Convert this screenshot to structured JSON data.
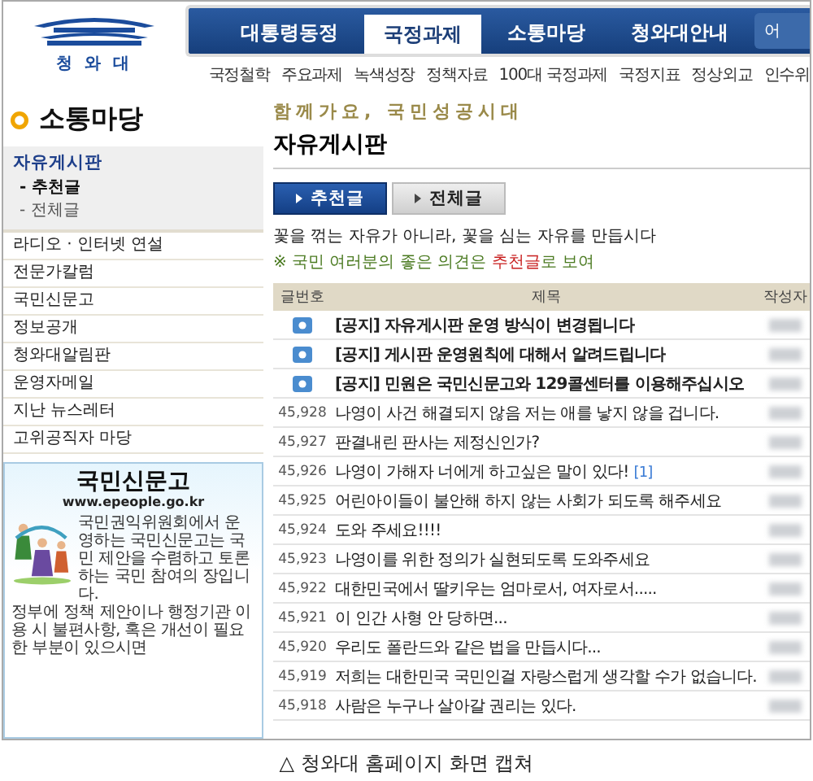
{
  "logo": {
    "text": "청 와 대"
  },
  "nav": {
    "tabs": [
      {
        "label": "대통령동정",
        "selected": false
      },
      {
        "label": "국정과제",
        "selected": true
      },
      {
        "label": "소통마당",
        "selected": false
      },
      {
        "label": "청와대안내",
        "selected": false
      }
    ],
    "search": {
      "value": "어"
    }
  },
  "subnav": [
    "국정철학",
    "주요과제",
    "녹색성장",
    "정책자료",
    "100대 국정과제",
    "국정지표",
    "정상외교",
    "인수위"
  ],
  "section_title": "소통마당",
  "sidebar": {
    "items": [
      {
        "label": "자유게시판",
        "selected": true,
        "children": [
          {
            "label": "- 추천글",
            "selected": true
          },
          {
            "label": "- 전체글",
            "selected": false
          }
        ]
      },
      {
        "label": "라디오 · 인터넷 연설",
        "selected": false
      },
      {
        "label": "전문가칼럼",
        "selected": false
      },
      {
        "label": "국민신문고",
        "selected": false
      },
      {
        "label": "정보공개",
        "selected": false
      },
      {
        "label": "청와대알림판",
        "selected": false
      },
      {
        "label": "운영자메일",
        "selected": false
      },
      {
        "label": "지난 뉴스레터",
        "selected": false
      },
      {
        "label": "고위공직자 마당",
        "selected": false
      }
    ]
  },
  "promo": {
    "title": "국민신문고",
    "url": "www.epeople.go.kr",
    "text": "국민권익위원회에서 운영하는 국민신문고는 국민 제안을 수렴하고 토론하는 국민 참여의 장입니다.",
    "footer": "정부에 정책 제안이나 행정기관 이용 시 불편사항, 혹은 개선이 필요한 부분이 있으시면"
  },
  "slogan": "함께가요, 국민성공시대",
  "page_title": "자유게시판",
  "board_tabs": [
    {
      "label": "추천글",
      "selected": true
    },
    {
      "label": "전체글",
      "selected": false
    }
  ],
  "motto": "꽃을 꺾는 자유가 아니라, 꽃을 심는 자유를 만듭시다",
  "notice": {
    "prefix": "※ 국민 여러분의 좋은 의견은 ",
    "highlight": "추천글",
    "suffix": "로 보여"
  },
  "table": {
    "columns": [
      "글번호",
      "제목",
      "작성자"
    ],
    "rows": [
      {
        "kind": "notice",
        "title": "[공지] 자유게시판 운영 방식이 변경됩니다"
      },
      {
        "kind": "notice",
        "title": "[공지] 게시판 운영원칙에 대해서 알려드립니다"
      },
      {
        "kind": "notice",
        "title": "[공지] 민원은 국민신문고와 129콜센터를 이용해주십시오"
      },
      {
        "kind": "post",
        "number": "45,928",
        "title": "나영이 사건 해결되지 않음 저는 애를 낳지 않을 겁니다."
      },
      {
        "kind": "post",
        "number": "45,927",
        "title": "판결내린 판사는 제정신인가?"
      },
      {
        "kind": "post",
        "number": "45,926",
        "title": "나영이 가해자 너에게 하고싶은 말이 있다!",
        "comments": "[1]"
      },
      {
        "kind": "post",
        "number": "45,925",
        "title": "어린아이들이 불안해 하지 않는 사회가 되도록 해주세요"
      },
      {
        "kind": "post",
        "number": "45,924",
        "title": "도와 주세요!!!!"
      },
      {
        "kind": "post",
        "number": "45,923",
        "title": "나영이를 위한 정의가 실현되도록 도와주세요"
      },
      {
        "kind": "post",
        "number": "45,922",
        "title": "대한민국에서 딸키우는 엄마로서, 여자로서....."
      },
      {
        "kind": "post",
        "number": "45,921",
        "title": "이 인간 사형 안 당하면..."
      },
      {
        "kind": "post",
        "number": "45,920",
        "title": "우리도 폴란드와 같은 법을 만듭시다..."
      },
      {
        "kind": "post",
        "number": "45,919",
        "title": "저희는 대한민국 국민인걸 자랑스럽게 생각할 수가 없습니다."
      },
      {
        "kind": "post",
        "number": "45,918",
        "title": "사람은 누구나 살아갈 권리는 있다."
      }
    ]
  },
  "caption": "△ 청와대 홈페이지 화면 캡쳐"
}
